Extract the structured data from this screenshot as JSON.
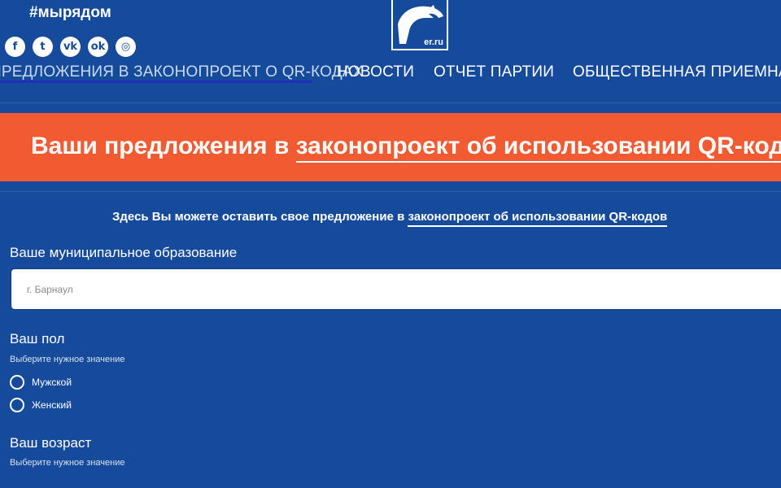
{
  "header": {
    "hashtag": "#мырядом",
    "socials": [
      {
        "icon": "facebook-icon",
        "glyph": "f"
      },
      {
        "icon": "twitter-icon",
        "glyph": "t"
      },
      {
        "icon": "vk-icon",
        "glyph": "vk"
      },
      {
        "icon": "odnoklassniki-icon",
        "glyph": "ok"
      },
      {
        "icon": "instagram-icon",
        "glyph": "◎"
      }
    ],
    "logo_text": "er.ru"
  },
  "nav": {
    "items": [
      {
        "label": "ПРЕДЛОЖЕНИЯ В ЗАКОНОПРОЕКТ О QR-КОДАХ",
        "active": true
      },
      {
        "label": "НОВОСТИ",
        "active": false
      },
      {
        "label": "ОТЧЕТ ПАРТИИ",
        "active": false
      },
      {
        "label": "ОБЩЕСТВЕННАЯ ПРИЕМНАЯ",
        "active": false
      }
    ]
  },
  "banner": {
    "title_prefix": "Ваши предложения в ",
    "title_link": "законопроект об использовании QR-кодов"
  },
  "intro": {
    "prefix": "Здесь Вы можете оставить свое предложение в ",
    "link": "законопроект об использовании QR-кодов"
  },
  "form": {
    "municipality": {
      "label": "Ваше муниципальное образование",
      "placeholder": "г. Барнаул",
      "value": ""
    },
    "gender": {
      "label": "Ваш пол",
      "hint": "Выберите нужное значение",
      "options": [
        "Мужской",
        "Женский"
      ]
    },
    "age": {
      "label": "Ваш возраст",
      "hint": "Выберите нужное значение"
    }
  },
  "colors": {
    "background": "#164a9a",
    "banner": "#f25a32",
    "nav_underline": "#1f2fb8"
  }
}
